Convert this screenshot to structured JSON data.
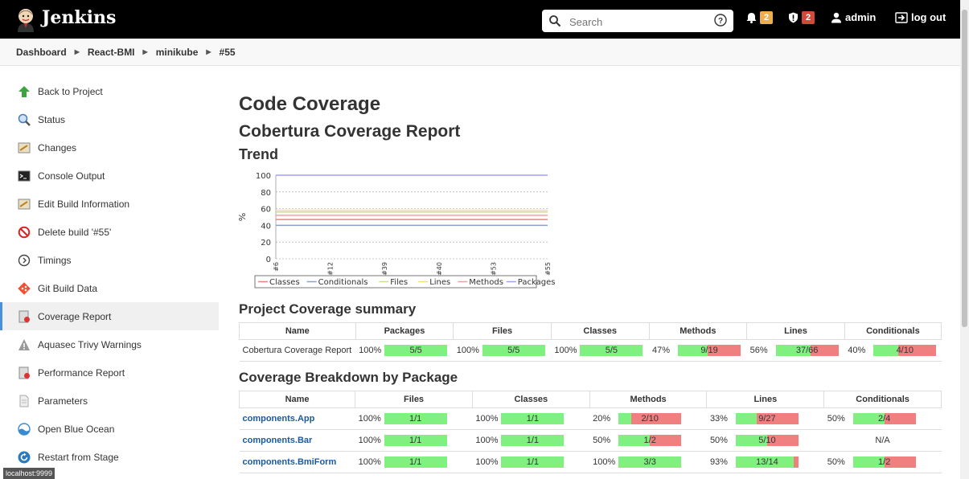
{
  "header": {
    "brand": "Jenkins",
    "search_placeholder": "Search",
    "notifications_count": "2",
    "security_count": "2",
    "user": "admin",
    "logout": "log out"
  },
  "breadcrumb": [
    "Dashboard",
    "React-BMI",
    "minikube",
    "#55"
  ],
  "sidebar": {
    "items": [
      {
        "label": "Back to Project",
        "icon": "up-arrow-icon"
      },
      {
        "label": "Status",
        "icon": "magnifier-icon"
      },
      {
        "label": "Changes",
        "icon": "notepad-icon"
      },
      {
        "label": "Console Output",
        "icon": "terminal-icon"
      },
      {
        "label": "Edit Build Information",
        "icon": "notepad-icon"
      },
      {
        "label": "Delete build '#55'",
        "icon": "no-entry-icon"
      },
      {
        "label": "Timings",
        "icon": "clock-icon"
      },
      {
        "label": "Git Build Data",
        "icon": "git-icon"
      },
      {
        "label": "Coverage Report",
        "icon": "report-icon"
      },
      {
        "label": "Aquasec Trivy Warnings",
        "icon": "warning-icon"
      },
      {
        "label": "Performance Report",
        "icon": "report-icon"
      },
      {
        "label": "Parameters",
        "icon": "document-icon"
      },
      {
        "label": "Open Blue Ocean",
        "icon": "blue-ocean-icon"
      },
      {
        "label": "Restart from Stage",
        "icon": "restart-icon"
      }
    ],
    "active_index": 8
  },
  "statusbar": "localhost:9999",
  "main": {
    "title": "Code Coverage",
    "subtitle": "Cobertura Coverage Report",
    "trend_heading": "Trend",
    "summary_heading": "Project Coverage summary",
    "breakdown_heading": "Coverage Breakdown by Package"
  },
  "chart_data": {
    "type": "line",
    "ylabel": "%",
    "ylim": [
      0,
      100
    ],
    "yticks": [
      0,
      20,
      40,
      60,
      80,
      100
    ],
    "x": [
      "#6",
      "#12",
      "#39",
      "#40",
      "#53",
      "#55"
    ],
    "grid": true,
    "legend_placement": "bottom",
    "series": [
      {
        "name": "Classes",
        "color": "#f08080",
        "values": [
          47,
          47,
          47,
          47,
          47,
          47
        ]
      },
      {
        "name": "Conditionals",
        "color": "#8aa0c8",
        "values": [
          40,
          40,
          40,
          40,
          40,
          40
        ]
      },
      {
        "name": "Files",
        "color": "#c8e08a",
        "values": [
          56,
          56,
          56,
          56,
          56,
          56
        ]
      },
      {
        "name": "Lines",
        "color": "#f0e080",
        "values": [
          58,
          58,
          58,
          58,
          58,
          58
        ]
      },
      {
        "name": "Methods",
        "color": "#f0a0a0",
        "values": [
          52,
          52,
          52,
          52,
          52,
          52
        ]
      },
      {
        "name": "Packages",
        "color": "#a0a0f0",
        "values": [
          100,
          100,
          100,
          100,
          100,
          100
        ]
      }
    ]
  },
  "summary_table": {
    "columns": [
      "Name",
      "Packages",
      "Files",
      "Classes",
      "Methods",
      "Lines",
      "Conditionals"
    ],
    "rows": [
      {
        "name": "Cobertura Coverage Report",
        "cells": [
          {
            "pct": "100%",
            "label": "5/5",
            "fraction": 1.0
          },
          {
            "pct": "100%",
            "label": "5/5",
            "fraction": 1.0
          },
          {
            "pct": "100%",
            "label": "5/5",
            "fraction": 1.0
          },
          {
            "pct": "47%",
            "label": "9/19",
            "fraction": 0.47
          },
          {
            "pct": "56%",
            "label": "37/66",
            "fraction": 0.56
          },
          {
            "pct": "40%",
            "label": "4/10",
            "fraction": 0.4
          }
        ]
      }
    ]
  },
  "breakdown_table": {
    "columns": [
      "Name",
      "Files",
      "Classes",
      "Methods",
      "Lines",
      "Conditionals"
    ],
    "rows": [
      {
        "name": "components.App",
        "cells": [
          {
            "pct": "100%",
            "label": "1/1",
            "fraction": 1.0
          },
          {
            "pct": "100%",
            "label": "1/1",
            "fraction": 1.0
          },
          {
            "pct": "20%",
            "label": "2/10",
            "fraction": 0.2
          },
          {
            "pct": "33%",
            "label": "9/27",
            "fraction": 0.33
          },
          {
            "pct": "50%",
            "label": "2/4",
            "fraction": 0.5
          }
        ]
      },
      {
        "name": "components.Bar",
        "cells": [
          {
            "pct": "100%",
            "label": "1/1",
            "fraction": 1.0
          },
          {
            "pct": "100%",
            "label": "1/1",
            "fraction": 1.0
          },
          {
            "pct": "50%",
            "label": "1/2",
            "fraction": 0.5
          },
          {
            "pct": "50%",
            "label": "5/10",
            "fraction": 0.5
          },
          {
            "na": "N/A"
          }
        ]
      },
      {
        "name": "components.BmiForm",
        "cells": [
          {
            "pct": "100%",
            "label": "1/1",
            "fraction": 1.0
          },
          {
            "pct": "100%",
            "label": "1/1",
            "fraction": 1.0
          },
          {
            "pct": "100%",
            "label": "3/3",
            "fraction": 1.0
          },
          {
            "pct": "93%",
            "label": "13/14",
            "fraction": 0.93
          },
          {
            "pct": "50%",
            "label": "1/2",
            "fraction": 0.5
          }
        ]
      }
    ]
  }
}
